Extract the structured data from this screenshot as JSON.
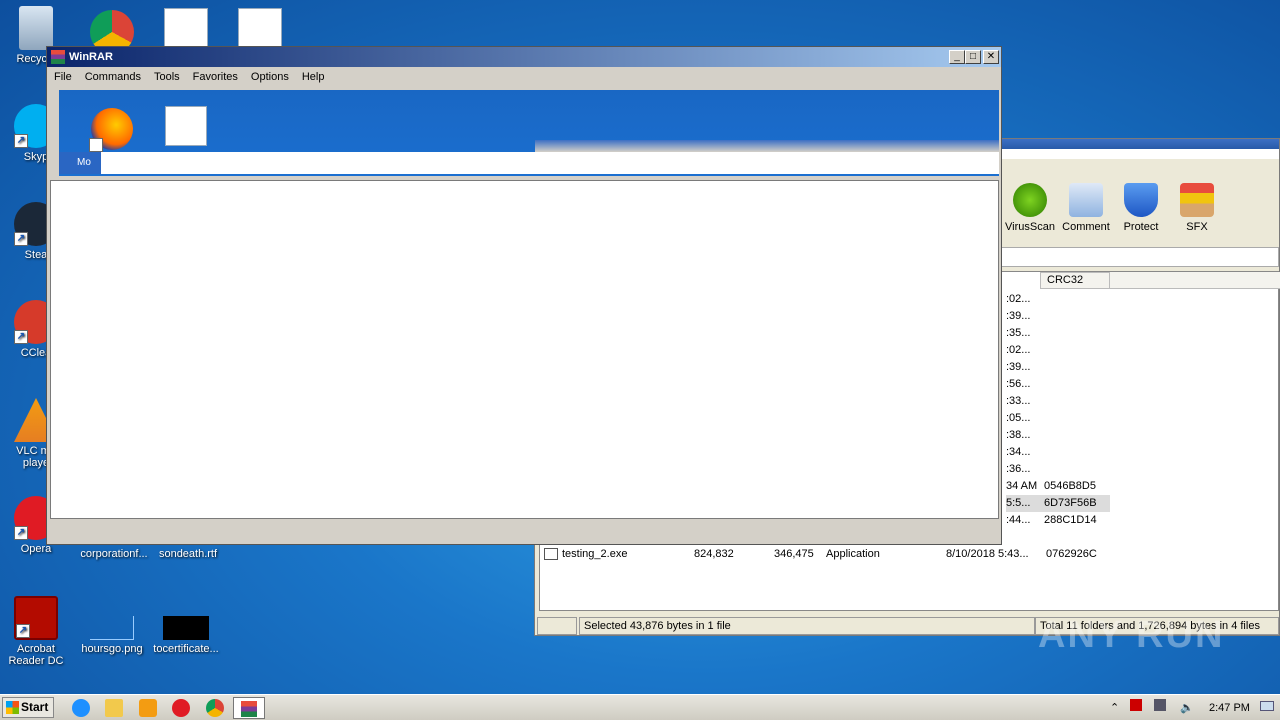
{
  "desktop": {
    "icons_left": [
      {
        "label": "Recycle",
        "name": "recycle-bin"
      },
      {
        "label": "Skyp",
        "name": "skype"
      },
      {
        "label": "Stea",
        "name": "steam"
      },
      {
        "label": "CClea",
        "name": "ccleaner"
      },
      {
        "label": "VLC me\nplaye",
        "name": "vlc"
      },
      {
        "label": "Opera",
        "name": "opera"
      },
      {
        "label": "Acrobat Reader DC",
        "name": "acrobat"
      }
    ],
    "other_icons": [
      {
        "label": "corporationf...",
        "name": "corporation-doc"
      },
      {
        "label": "sondeath.rtf",
        "name": "sondeath-rtf"
      },
      {
        "label": "hoursgo.png",
        "name": "hoursgo-png"
      },
      {
        "label": "tocertificate...",
        "name": "tocertificate"
      }
    ]
  },
  "fg_window": {
    "title": "WinRAR",
    "menu": [
      "File",
      "Commands",
      "Tools",
      "Favorites",
      "Options",
      "Help"
    ],
    "inner_label": "Mo",
    "controls": {
      "minimize": "_",
      "maximize": "□",
      "close": "✕"
    }
  },
  "bg_window": {
    "toolbar": [
      "VirusScan",
      "Comment",
      "Protect",
      "SFX"
    ],
    "column_header": "CRC32",
    "rows": [
      {
        "time": ":02...",
        "crc": ""
      },
      {
        "time": ":39...",
        "crc": ""
      },
      {
        "time": ":35...",
        "crc": ""
      },
      {
        "time": ":02...",
        "crc": ""
      },
      {
        "time": ":39...",
        "crc": ""
      },
      {
        "time": ":56...",
        "crc": ""
      },
      {
        "time": ":33...",
        "crc": ""
      },
      {
        "time": ":05...",
        "crc": ""
      },
      {
        "time": ":38...",
        "crc": ""
      },
      {
        "time": ":34...",
        "crc": ""
      },
      {
        "time": ":36...",
        "crc": ""
      },
      {
        "time": "34 AM",
        "crc": "0546B8D5"
      },
      {
        "time": "5:5...",
        "crc": "6D73F56B"
      },
      {
        "time": ":44...",
        "crc": "288C1D14"
      }
    ],
    "testing_row": {
      "name": "testing_2.exe",
      "size": "824,832",
      "packed": "346,475",
      "type": "Application",
      "modified": "8/10/2018 5:43...",
      "crc": "0762926C"
    },
    "status_left": "Selected 43,876 bytes in 1 file",
    "status_right": "Total 11 folders and 1,726,894 bytes in 4 files"
  },
  "taskbar": {
    "start": "Start",
    "clock": "2:47 PM"
  },
  "watermark": "ANY RUN"
}
